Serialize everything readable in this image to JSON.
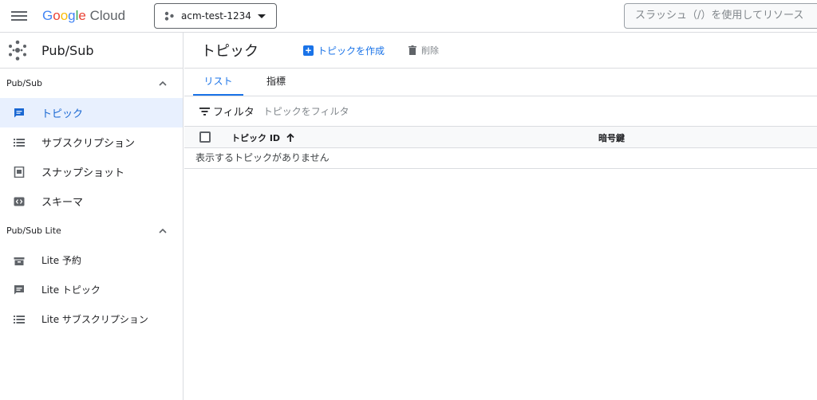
{
  "header": {
    "logo": {
      "g1": "G",
      "g2": "o",
      "g3": "o",
      "g4": "g",
      "g5": "l",
      "g6": "e",
      "cloud": "Cloud"
    },
    "project_name": "acm-test-1234",
    "search_placeholder": "スラッシュ（/）を使用してリソース"
  },
  "sidebar": {
    "product_title": "Pub/Sub",
    "sections": [
      {
        "title": "Pub/Sub",
        "items": [
          {
            "label": "トピック",
            "icon": "topic-icon",
            "active": true
          },
          {
            "label": "サブスクリプション",
            "icon": "list-icon"
          },
          {
            "label": "スナップショット",
            "icon": "snapshot-icon"
          },
          {
            "label": "スキーマ",
            "icon": "schema-icon"
          }
        ]
      },
      {
        "title": "Pub/Sub Lite",
        "items": [
          {
            "label": "Lite 予約",
            "icon": "reservation-icon"
          },
          {
            "label": "Lite トピック",
            "icon": "topic-icon"
          },
          {
            "label": "Lite サブスクリプション",
            "icon": "list-icon"
          }
        ]
      }
    ]
  },
  "main": {
    "title": "トピック",
    "create_label": "トピックを作成",
    "create_icon": "+",
    "delete_label": "削除",
    "tabs": [
      {
        "label": "リスト",
        "active": true
      },
      {
        "label": "指標"
      }
    ],
    "filter_label": "フィルタ",
    "filter_placeholder": "トピックをフィルタ",
    "table": {
      "columns": [
        "トピック ID",
        "暗号鍵"
      ],
      "empty_message": "表示するトピックがありません"
    }
  },
  "colors": {
    "accent": "#1a73e8",
    "active_bg": "#e8f0fe",
    "border": "#dadce0"
  }
}
